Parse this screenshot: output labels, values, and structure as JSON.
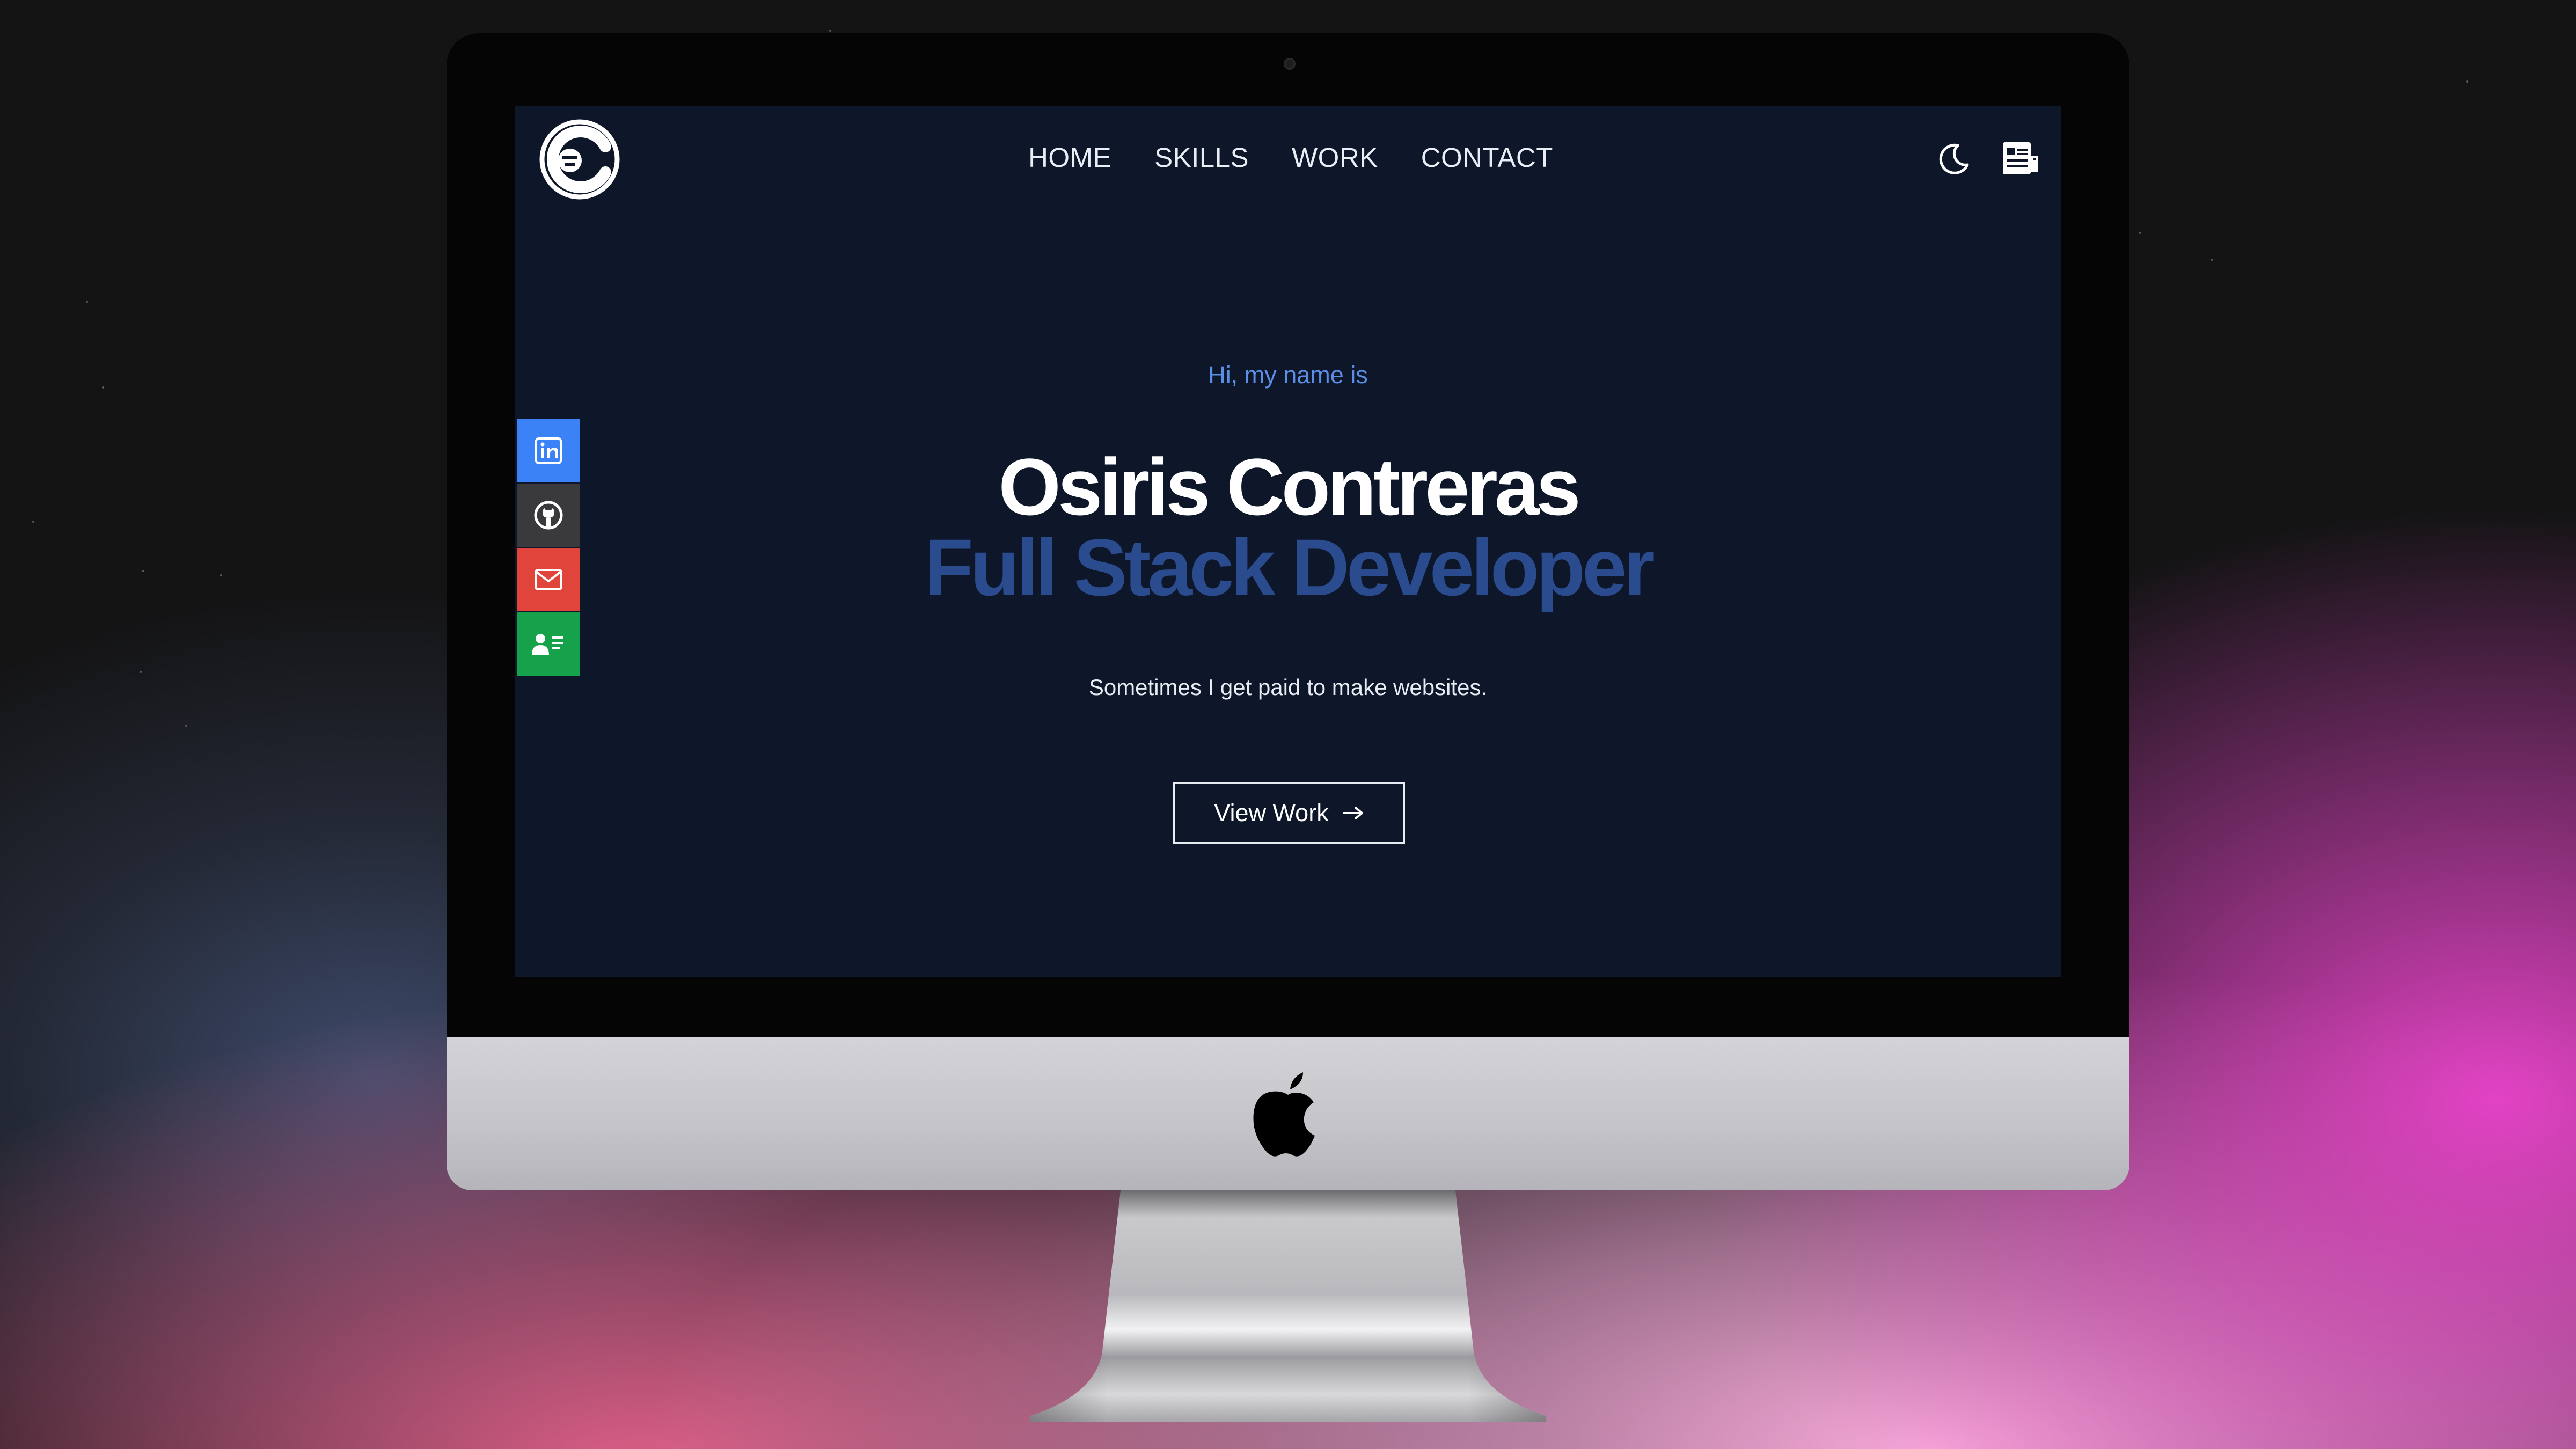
{
  "site": {
    "logo_icon": "gorilla-c-logo-icon",
    "nav": [
      {
        "label": "HOME"
      },
      {
        "label": "SKILLS"
      },
      {
        "label": "WORK"
      },
      {
        "label": "CONTACT"
      }
    ],
    "theme_icon": "moon-icon",
    "resume_icon": "resume-document-icon"
  },
  "social": [
    {
      "icon": "linkedin-icon",
      "color": "#3b82f6"
    },
    {
      "icon": "github-icon",
      "color": "#3a3a3c"
    },
    {
      "icon": "mail-icon",
      "color": "#e1443b"
    },
    {
      "icon": "contact-card-icon",
      "color": "#16a24b"
    }
  ],
  "hero": {
    "greeting": "Hi, my name is",
    "name": "Osiris Contreras",
    "role": "Full Stack Developer",
    "tagline": "Sometimes I get paid to make websites.",
    "cta_label": "View Work",
    "cta_icon": "arrow-right-icon"
  },
  "colors": {
    "screen_bg": "#0e1629",
    "accent_blue": "#5b8fe6",
    "role_blue": "#2a4b8e"
  },
  "device": {
    "logo_icon": "apple-logo-icon"
  }
}
